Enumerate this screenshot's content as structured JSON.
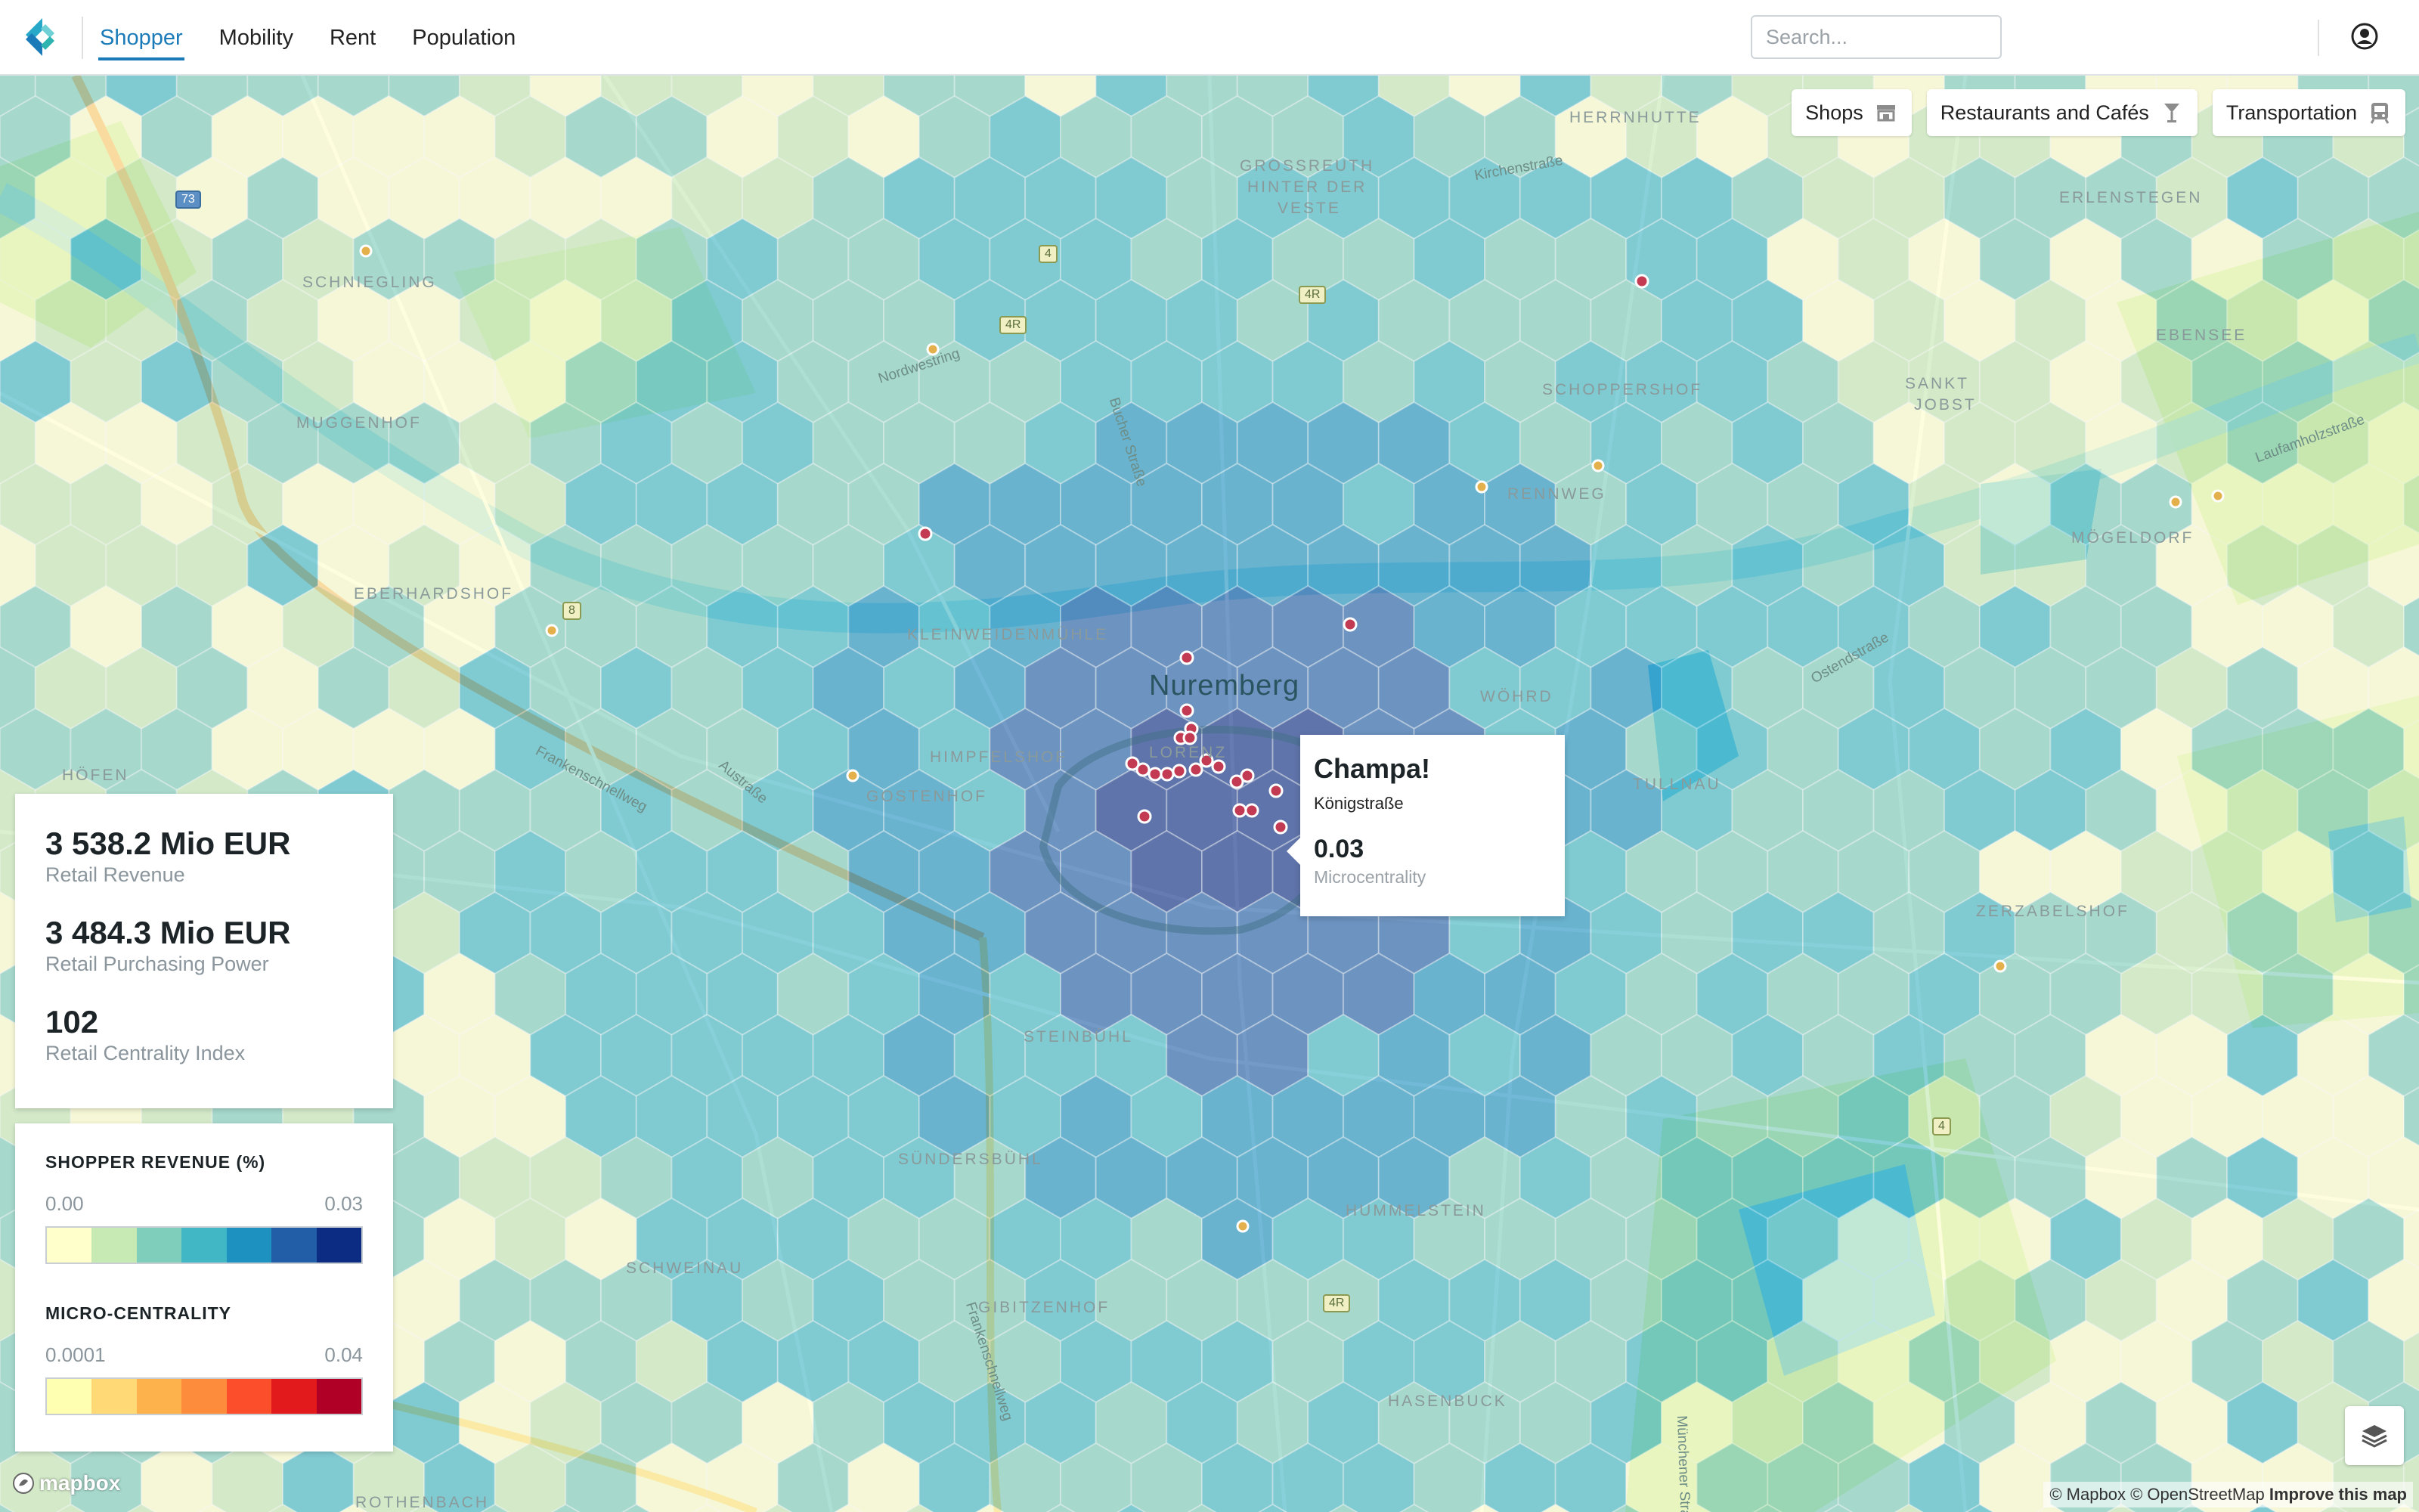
{
  "nav": {
    "items": [
      {
        "label": "Shopper"
      },
      {
        "label": "Mobility"
      },
      {
        "label": "Rent"
      },
      {
        "label": "Population"
      }
    ],
    "active": "Shopper"
  },
  "search": {
    "placeholder": "Search..."
  },
  "filters": {
    "shops": "Shops",
    "restaurants": "Restaurants and Cafés",
    "transportation": "Transportation"
  },
  "stats": {
    "revenue_value": "3 538.2 Mio EUR",
    "revenue_label": "Retail Revenue",
    "power_value": "3 484.3 Mio EUR",
    "power_label": "Retail Purchasing Power",
    "index_value": "102",
    "index_label": "Retail Centrality Index"
  },
  "legend": {
    "shopper_title": "SHOPPER REVENUE (%)",
    "shopper_min": "0.00",
    "shopper_max": "0.03",
    "shopper_colors": [
      "#ffffcc",
      "#c7e9b4",
      "#7fcdbb",
      "#41b6c4",
      "#1d91c0",
      "#225ea8",
      "#0c2c84"
    ],
    "micro_title": "MICRO-CENTRALITY",
    "micro_min": "0.0001",
    "micro_max": "0.04",
    "micro_colors": [
      "#ffffb2",
      "#fed976",
      "#feb24c",
      "#fd8d3c",
      "#fc4e2a",
      "#e31a1c",
      "#b10026"
    ]
  },
  "popup": {
    "title": "Champa!",
    "subtitle": "Königstraße",
    "value": "0.03",
    "label": "Microcentrality"
  },
  "map": {
    "city": "Nuremberg",
    "districts": [
      "HERRNHUTTE",
      "GROSSREUTH",
      "HINTER DER",
      "VESTE",
      "ERLENSTEGEN",
      "SCHNIEGLING",
      "EBENSEE",
      "SANKT",
      "JOBST",
      "MUGGENHOF",
      "SCHOPPERSHOF",
      "RENNWEG",
      "MÖGELDORF",
      "EBERHARDSHOF",
      "KLEINWEIDENMÜHLE",
      "WÖHRD",
      "HÖFEN",
      "HIMPFELSHOF",
      "LORENZ",
      "TULLNAU",
      "GOSTENHOF",
      "ZERZABELSHOF",
      "STEINBÜHL",
      "SÜNDERSBÜHL",
      "HUMMELSTEIN",
      "SCHWEINAU",
      "GIBITZENHOF",
      "HASENBUCK",
      "ROTHENBACH"
    ],
    "roads": [
      "Kirchenstraße",
      "Nordwestring",
      "Bucher Straße",
      "Laufamholzstraße",
      "Frankenschnellweg",
      "Austraße",
      "Ostendstraße",
      "Frankenschnellweg",
      "Münchener Straße"
    ],
    "shields": [
      "73",
      "4",
      "4R",
      "4R",
      "8",
      "4",
      "4R"
    ]
  },
  "attribution": {
    "mapbox": "mapbox",
    "mapbox_credit": "© Mapbox",
    "osm_credit": "© OpenStreetMap",
    "improve": "Improve this map"
  }
}
